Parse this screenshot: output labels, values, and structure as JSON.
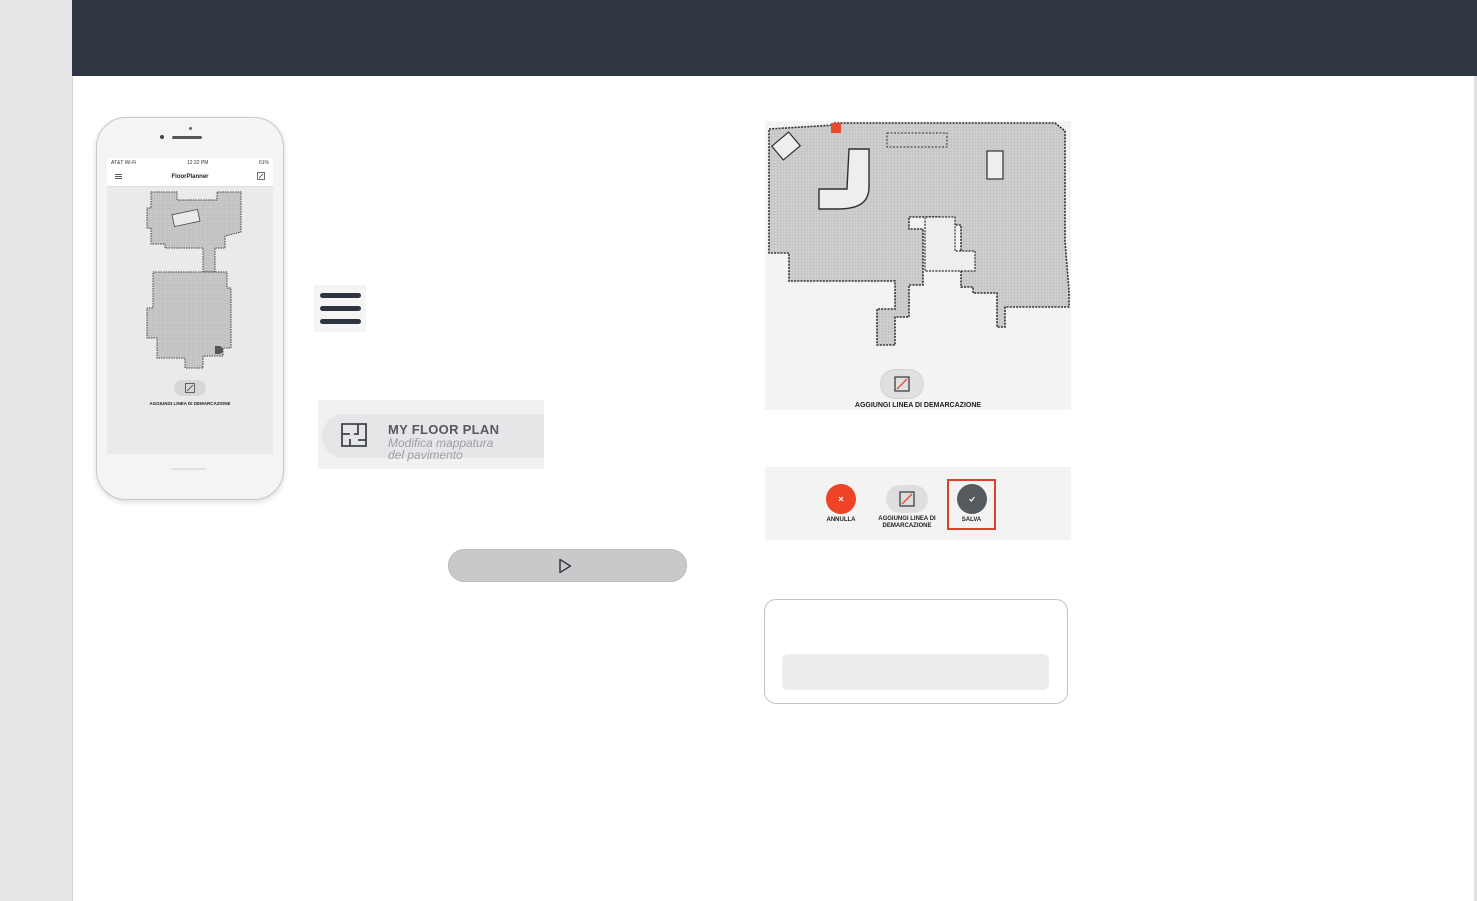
{
  "phone": {
    "status": {
      "carrier": "AT&T Wi-Fi",
      "time": "12:32 PM",
      "battery": "61%"
    },
    "app_title": "FloorPlanner",
    "line_label": "AGGIUNGI LINEA DI DEMARCAZIONE"
  },
  "floorplan_card": {
    "title": "MY FLOOR PLAN",
    "subtitle_1": "Modifica mappatura",
    "subtitle_2": "del pavimento"
  },
  "map_panel": {
    "line_label": "AGGIUNGI LINEA DI DEMARCAZIONE"
  },
  "actions": {
    "cancel_label": "ANNULLA",
    "line_label_1": "AGGIUNGI LINEA DI",
    "line_label_2": "DEMARCAZIONE",
    "save_label": "SALVA"
  },
  "colors": {
    "header": "#303642",
    "cancel": "#ee4327",
    "save": "#555a5f",
    "highlight": "#d9432b"
  },
  "icons": [
    "hamburger-menu-icon",
    "floor-plan-icon",
    "play-icon",
    "line-edit-icon",
    "close-icon",
    "check-icon",
    "robot-marker-icon"
  ]
}
